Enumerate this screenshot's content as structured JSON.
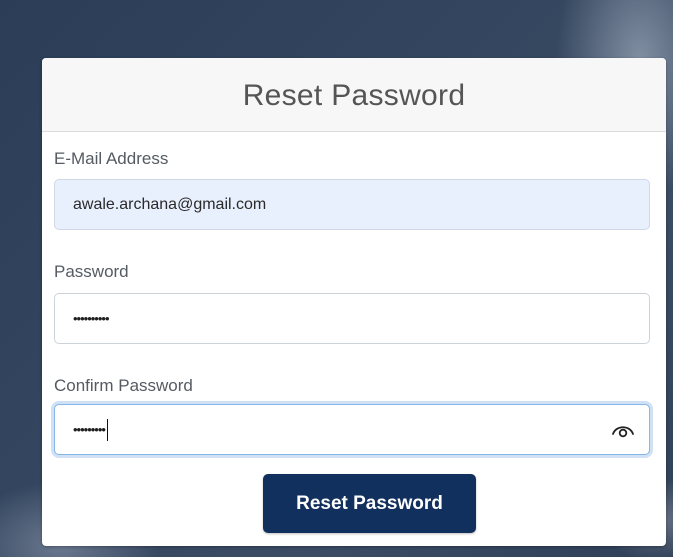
{
  "form": {
    "title": "Reset Password",
    "email": {
      "label": "E-Mail Address",
      "value": "awale.archana@gmail.com"
    },
    "password": {
      "label": "Password",
      "masked_value": "••••••••••"
    },
    "confirm_password": {
      "label": "Confirm Password",
      "masked_value": "•••••••••"
    },
    "submit_label": "Reset Password"
  },
  "icons": {
    "show_password": "eye-icon"
  },
  "colors": {
    "button_bg": "#12305d",
    "autofill_bg": "#e8f0fe",
    "focus_ring": "#86b7e8"
  }
}
